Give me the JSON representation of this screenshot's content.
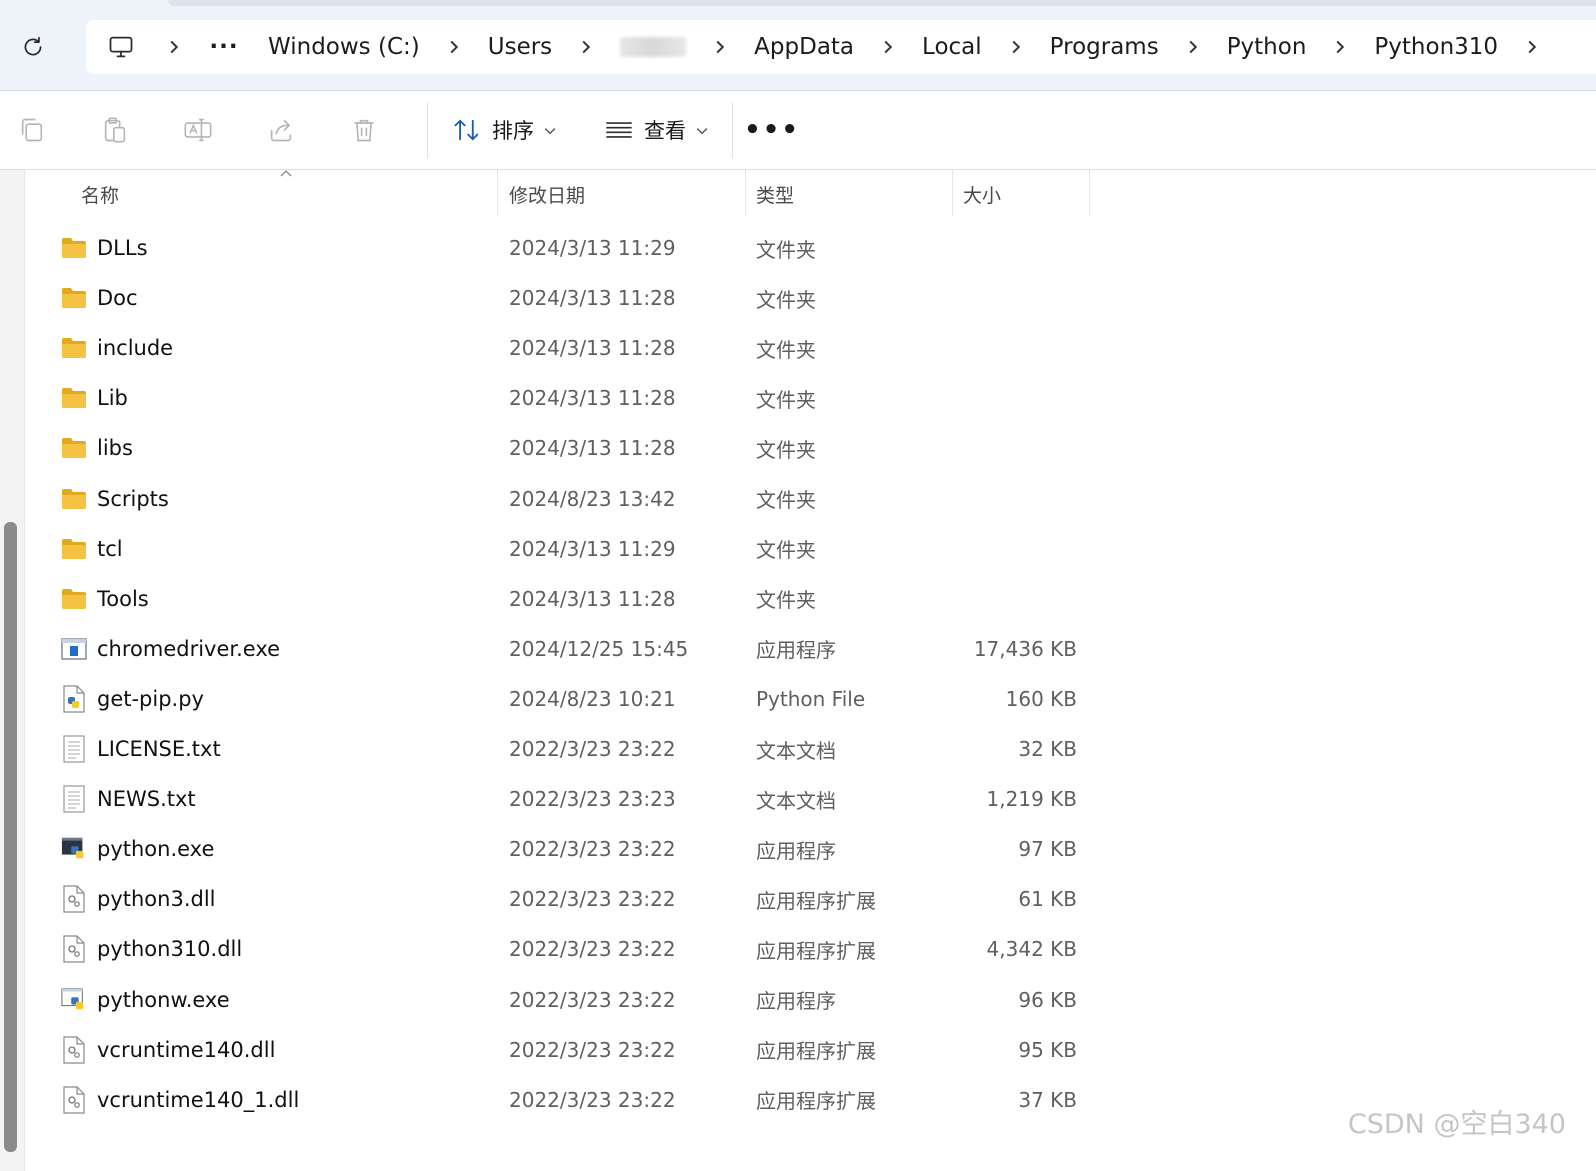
{
  "addressbar": {
    "crumbs": [
      "Windows (C:)",
      "Users",
      "AppData",
      "Local",
      "Programs",
      "Python",
      "Python310"
    ],
    "more_glyph": "···"
  },
  "toolbar": {
    "sort_label": "排序",
    "view_label": "查看",
    "more_glyph": "•••"
  },
  "columns": {
    "name": "名称",
    "modified": "修改日期",
    "type": "类型",
    "size": "大小"
  },
  "files": [
    {
      "name": "DLLs",
      "date": "2024/3/13 11:29",
      "type": "文件夹",
      "size": "",
      "icon": "folder-icon"
    },
    {
      "name": "Doc",
      "date": "2024/3/13 11:28",
      "type": "文件夹",
      "size": "",
      "icon": "folder-icon"
    },
    {
      "name": "include",
      "date": "2024/3/13 11:28",
      "type": "文件夹",
      "size": "",
      "icon": "folder-icon"
    },
    {
      "name": "Lib",
      "date": "2024/3/13 11:28",
      "type": "文件夹",
      "size": "",
      "icon": "folder-icon"
    },
    {
      "name": "libs",
      "date": "2024/3/13 11:28",
      "type": "文件夹",
      "size": "",
      "icon": "folder-icon"
    },
    {
      "name": "Scripts",
      "date": "2024/8/23 13:42",
      "type": "文件夹",
      "size": "",
      "icon": "folder-icon"
    },
    {
      "name": "tcl",
      "date": "2024/3/13 11:29",
      "type": "文件夹",
      "size": "",
      "icon": "folder-icon"
    },
    {
      "name": "Tools",
      "date": "2024/3/13 11:28",
      "type": "文件夹",
      "size": "",
      "icon": "folder-icon"
    },
    {
      "name": "chromedriver.exe",
      "date": "2024/12/25 15:45",
      "type": "应用程序",
      "size": "17,436 KB",
      "icon": "app-window-icon"
    },
    {
      "name": "get-pip.py",
      "date": "2024/8/23 10:21",
      "type": "Python File",
      "size": "160 KB",
      "icon": "python-file-icon"
    },
    {
      "name": "LICENSE.txt",
      "date": "2022/3/23 23:22",
      "type": "文本文档",
      "size": "32 KB",
      "icon": "text-file-icon"
    },
    {
      "name": "NEWS.txt",
      "date": "2022/3/23 23:23",
      "type": "文本文档",
      "size": "1,219 KB",
      "icon": "text-file-icon"
    },
    {
      "name": "python.exe",
      "date": "2022/3/23 23:22",
      "type": "应用程序",
      "size": "97 KB",
      "icon": "python-app-icon"
    },
    {
      "name": "python3.dll",
      "date": "2022/3/23 23:22",
      "type": "应用程序扩展",
      "size": "61 KB",
      "icon": "dll-file-icon"
    },
    {
      "name": "python310.dll",
      "date": "2022/3/23 23:22",
      "type": "应用程序扩展",
      "size": "4,342 KB",
      "icon": "dll-file-icon"
    },
    {
      "name": "pythonw.exe",
      "date": "2022/3/23 23:22",
      "type": "应用程序",
      "size": "96 KB",
      "icon": "python-window-icon"
    },
    {
      "name": "vcruntime140.dll",
      "date": "2022/3/23 23:22",
      "type": "应用程序扩展",
      "size": "95 KB",
      "icon": "dll-file-icon"
    },
    {
      "name": "vcruntime140_1.dll",
      "date": "2022/3/23 23:22",
      "type": "应用程序扩展",
      "size": "37 KB",
      "icon": "dll-file-icon"
    }
  ],
  "watermark": "CSDN @空白340",
  "colors": {
    "accent": "#0067c0",
    "folder": "#f5c243",
    "folder_dark": "#e2a91c"
  }
}
